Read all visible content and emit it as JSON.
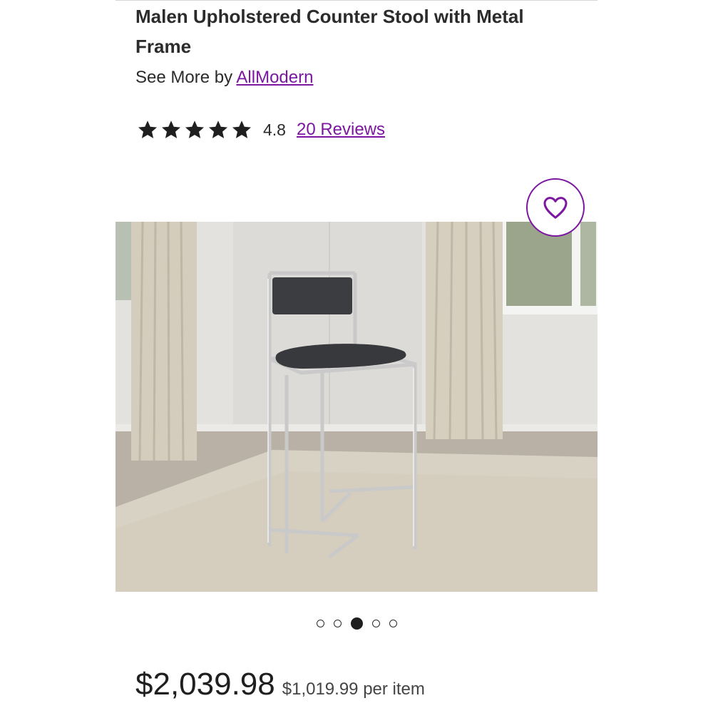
{
  "product": {
    "title": "Malen Upholstered Counter Stool with Metal Frame",
    "byline_prefix": "See More by",
    "brand": "AllModern"
  },
  "rating": {
    "stars": 5,
    "value": "4.8",
    "reviews_label": "20 Reviews"
  },
  "gallery": {
    "image_count": 5,
    "active_index": 2
  },
  "pricing": {
    "price": "$2,039.98",
    "unit_price": "$1,019.99 per item"
  },
  "colors": {
    "accent": "#7b189f",
    "text": "#2b2b2b"
  },
  "icons": {
    "favorite": "heart-icon",
    "rating": "star-icon"
  }
}
